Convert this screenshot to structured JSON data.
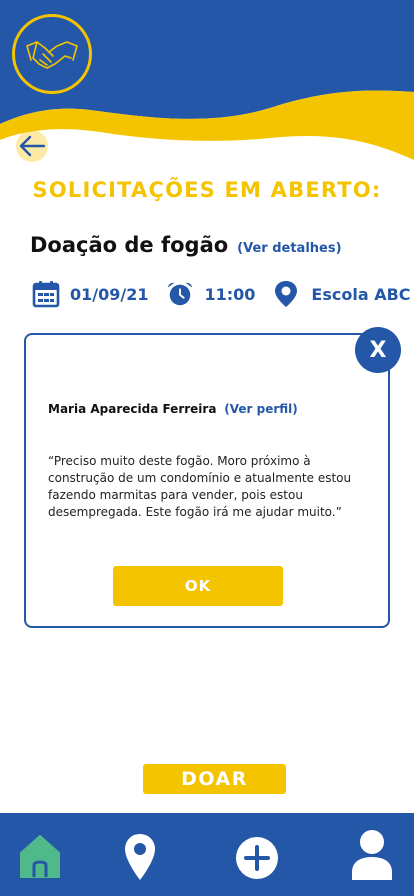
{
  "colors": {
    "primary": "#2457a7",
    "accent": "#f5c400",
    "home_active": "#4fb98a"
  },
  "header": {
    "logo_icon": "handshake-logo-icon",
    "back_icon": "arrow-left-icon"
  },
  "section_title": "SOLICITAÇÕES EM ABERTO:",
  "request": {
    "title": "Doação de fogão",
    "details_link": "(Ver detalhes)",
    "date": "01/09/21",
    "time": "11:00",
    "location": "Escola ABC"
  },
  "modal": {
    "close_label": "X",
    "requester_name": "Maria Aparecida Ferreira",
    "profile_link": "(Ver perfil)",
    "message": "“Preciso muito deste fogão. Moro próximo à construção de um condomínio e atualmente estou fazendo marmitas para vender, pois estou desempregada. Este fogão irá me ajudar muito.”",
    "ok_label": "OK"
  },
  "donate_label": "DOAR",
  "bottom_nav": [
    {
      "icon": "home-icon",
      "active": true
    },
    {
      "icon": "map-pin-icon",
      "active": false
    },
    {
      "icon": "plus-circle-icon",
      "active": false
    },
    {
      "icon": "user-icon",
      "active": false
    }
  ]
}
